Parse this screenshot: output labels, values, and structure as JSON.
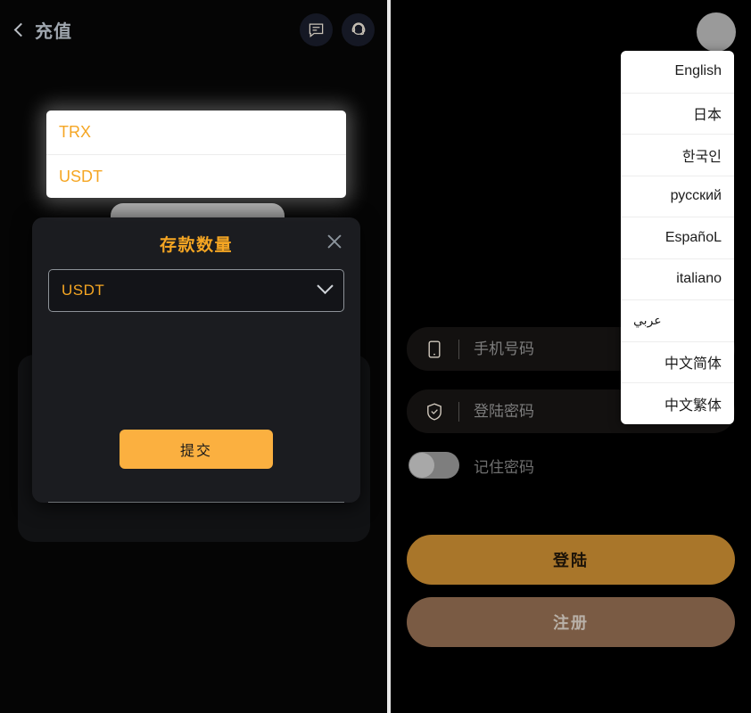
{
  "left": {
    "header": {
      "back_icon": "chevron-left-icon",
      "title": "充值",
      "actions": [
        {
          "icon": "chat-message-icon",
          "name": "message-button"
        },
        {
          "icon": "customer-service-headset-icon",
          "name": "support-button"
        }
      ]
    },
    "modal": {
      "title": "存款数量",
      "close_icon": "close-icon",
      "select": {
        "value": "USDT",
        "caret_icon": "chevron-down-icon",
        "options": [
          "TRX",
          "USDT"
        ],
        "expanded": true
      },
      "submit_label": "提交"
    }
  },
  "right": {
    "avatar": "user-avatar",
    "language_menu": {
      "open": true,
      "items": [
        "English",
        "日本",
        "한국인",
        "русский",
        "EspañoL",
        "italiano",
        "عربي",
        "中文简体",
        "中文繁体"
      ]
    },
    "login_form": {
      "phone": {
        "icon": "mobile-phone-icon",
        "placeholder": "手机号码",
        "value": ""
      },
      "password": {
        "icon": "shield-check-icon",
        "placeholder": "登陆密码",
        "value": ""
      },
      "remember": {
        "label": "记住密码",
        "checked": false
      },
      "login_label": "登陆",
      "register_label": "注册"
    }
  },
  "colors": {
    "accent_orange": "#f5a623",
    "submit_orange": "#fbb040",
    "login_brown": "#a9762a",
    "register_brown": "#7a5b44",
    "panel_bg": "#000000",
    "modal_bg": "#1b1c20"
  }
}
